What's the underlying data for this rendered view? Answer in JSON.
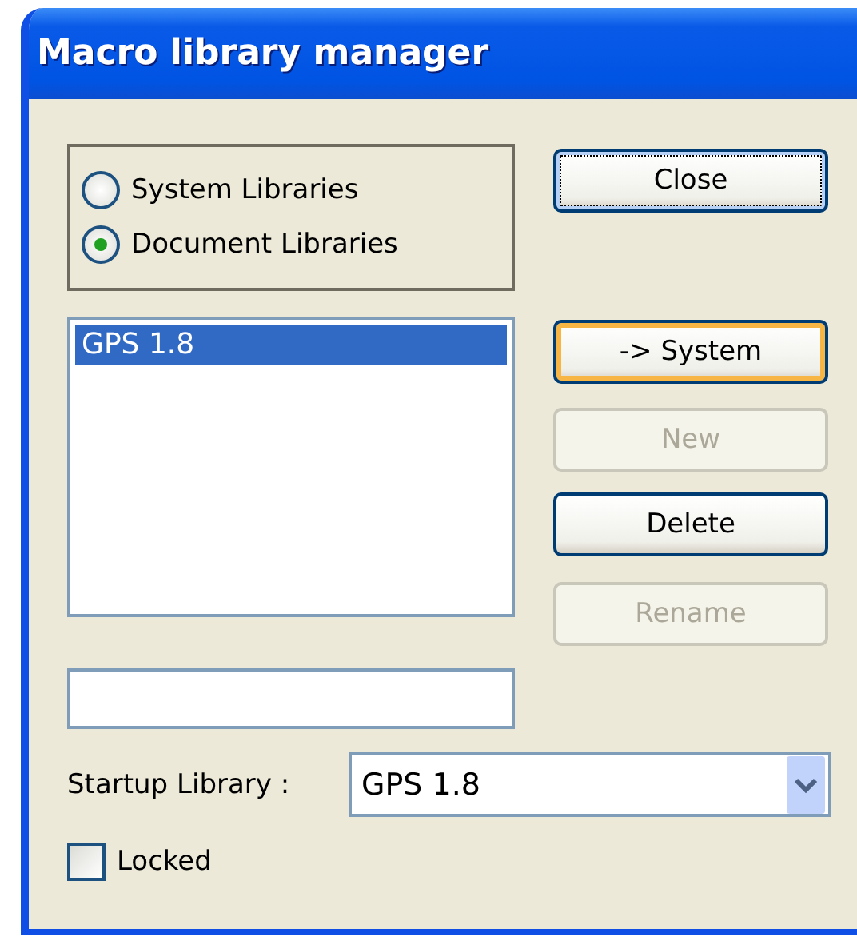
{
  "window": {
    "title": "Macro library manager"
  },
  "library_type": [
    {
      "label": "System Libraries",
      "selected": false
    },
    {
      "label": "Document Libraries",
      "selected": true
    }
  ],
  "libraries": [
    {
      "label": "GPS 1.8",
      "selected": true
    }
  ],
  "buttons": [
    {
      "label": "Close",
      "kind": "focused",
      "disabled": false
    },
    {
      "label": "-> System",
      "kind": "default",
      "disabled": false
    },
    {
      "label": "New",
      "kind": "normal",
      "disabled": true
    },
    {
      "label": "Delete",
      "kind": "normal",
      "disabled": false
    },
    {
      "label": "Rename",
      "kind": "normal",
      "disabled": true
    }
  ],
  "startup_library": {
    "label": "Startup Library :",
    "value": "GPS 1.8"
  },
  "locked": {
    "label": "Locked",
    "checked": false
  }
}
